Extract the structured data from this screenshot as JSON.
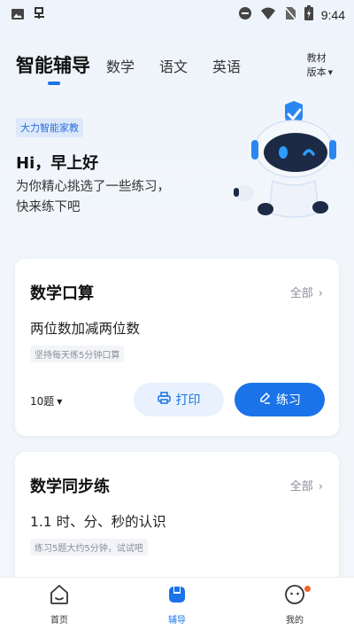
{
  "status_bar": {
    "time": "9:44",
    "icons": [
      "image-icon",
      "app-icon",
      "do-not-disturb-icon",
      "wifi-icon",
      "no-sim-icon",
      "battery-charging-icon"
    ]
  },
  "tabs": {
    "active": "智能辅导",
    "items": [
      "数学",
      "语文",
      "英语"
    ],
    "version_line1": "教材",
    "version_line2": "版本"
  },
  "hero": {
    "badge": "大力智能家教",
    "greeting": "Hi，早上好",
    "subtitle": "为你精心挑选了一些练习，快来练下吧",
    "robot": "robot-mascot-icon"
  },
  "cards": [
    {
      "title": "数学口算",
      "all_label": "全部",
      "subtitle": "两位数加减两位数",
      "tip": "坚持每天练5分钟口算",
      "count": "10题",
      "print_label": "打印",
      "practice_label": "练习"
    },
    {
      "title": "数学同步练",
      "all_label": "全部",
      "subtitle": "1.1 时、分、秒的认识",
      "tip": "练习5题大约5分钟，试试吧"
    }
  ],
  "bottom_nav": [
    {
      "label": "首页",
      "icon": "home-icon"
    },
    {
      "label": "辅导",
      "icon": "tutor-icon"
    },
    {
      "label": "我的",
      "icon": "profile-icon"
    }
  ],
  "colors": {
    "accent": "#1a73e8",
    "badge_bg": "#dde9fb",
    "notification_dot": "#f0642d"
  }
}
